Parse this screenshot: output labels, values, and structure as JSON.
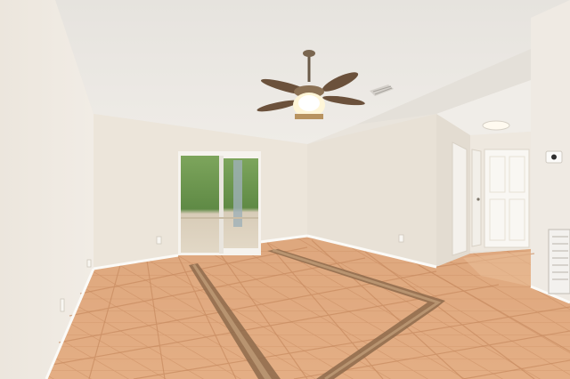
{
  "photo": {
    "subject": "empty-room-interior",
    "colors": {
      "ceiling": "#ebe8e3",
      "wall_left": "#efeae3",
      "wall_back": "#ece5db",
      "wall_right": "#e7e1d8",
      "floor_tile": "#e2aa7f",
      "floor_grout": "#c98a5e",
      "border_inlay": "#8d6a4b",
      "baseboard": "#fbfaf7",
      "door_frame": "#f6f3ee",
      "greenery": "#6f9a52"
    },
    "elements": [
      "ceiling-fan-with-light",
      "sliding-glass-door",
      "ceiling-vent",
      "hallway-opening",
      "interior-door",
      "wall-return-vent",
      "thermostat",
      "ceiling-light",
      "tile-floor-with-diagonal-inlay"
    ]
  }
}
